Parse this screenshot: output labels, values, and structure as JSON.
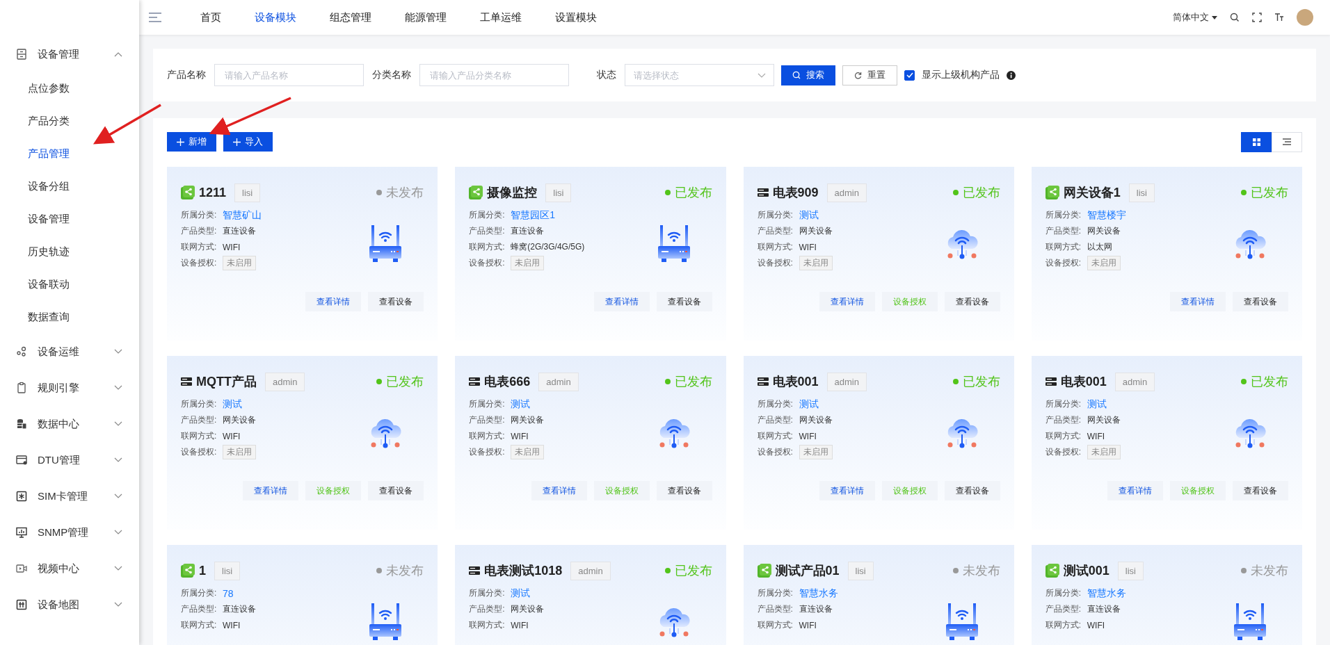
{
  "top_nav": {
    "tabs": [
      {
        "label": "首页",
        "selected": false
      },
      {
        "label": "设备模块",
        "selected": true
      },
      {
        "label": "组态管理",
        "selected": false
      },
      {
        "label": "能源管理",
        "selected": false
      },
      {
        "label": "工单运维",
        "selected": false
      },
      {
        "label": "设置模块",
        "selected": false
      }
    ],
    "language": "简体中文"
  },
  "sidebar": {
    "items": [
      {
        "label": "设备管理",
        "kind": "cabinet",
        "expanded": true,
        "children": [
          {
            "label": "点位参数",
            "selected": false
          },
          {
            "label": "产品分类",
            "selected": false
          },
          {
            "label": "产品管理",
            "selected": true
          },
          {
            "label": "设备分组",
            "selected": false
          },
          {
            "label": "设备管理",
            "selected": false
          },
          {
            "label": "历史轨迹",
            "selected": false
          },
          {
            "label": "设备联动",
            "selected": false
          },
          {
            "label": "数据查询",
            "selected": false
          }
        ]
      },
      {
        "label": "设备运维",
        "kind": "nodes",
        "expanded": false
      },
      {
        "label": "规则引擎",
        "kind": "clipboard",
        "expanded": false
      },
      {
        "label": "数据中心",
        "kind": "database",
        "expanded": false
      },
      {
        "label": "DTU管理",
        "kind": "dtu",
        "expanded": false
      },
      {
        "label": "SIM卡管理",
        "kind": "sim",
        "expanded": false
      },
      {
        "label": "SNMP管理",
        "kind": "monitor",
        "expanded": false
      },
      {
        "label": "视频中心",
        "kind": "video",
        "expanded": false
      },
      {
        "label": "设备地图",
        "kind": "map",
        "expanded": false
      }
    ]
  },
  "filter": {
    "fields": [
      {
        "label": "产品名称",
        "placeholder": "请输入产品名称",
        "kind": "input"
      },
      {
        "label": "分类名称",
        "placeholder": "请输入产品分类名称",
        "kind": "input"
      },
      {
        "label": "状态",
        "placeholder": "请选择状态",
        "kind": "select"
      }
    ],
    "search_button": "搜索",
    "reset_button": "重置",
    "show_parent": {
      "label": "显示上级机构产品",
      "checked": true
    }
  },
  "toolbar": {
    "add_button": "新增",
    "import_button": "导入",
    "view_modes": [
      {
        "kind": "grid",
        "selected": true
      },
      {
        "kind": "list",
        "selected": false
      }
    ]
  },
  "cards": [
    {
      "title": "1211",
      "owner": "lisi",
      "kind": "share-router",
      "status": "未发布",
      "published": false,
      "fields": [
        {
          "label": "所属分类:",
          "value": "智慧矿山",
          "kind": "link"
        },
        {
          "label": "产品类型:",
          "value": "直连设备",
          "kind": "text"
        },
        {
          "label": "联网方式:",
          "value": "WIFI",
          "kind": "text"
        },
        {
          "label": "设备授权:",
          "value": "未启用",
          "kind": "tag"
        }
      ],
      "actions": [
        {
          "label": "查看详情",
          "kind": "detail"
        },
        {
          "label": "查看设备",
          "kind": "device"
        }
      ]
    },
    {
      "title": "摄像监控",
      "owner": "lisi",
      "kind": "share-router",
      "status": "已发布",
      "published": true,
      "fields": [
        {
          "label": "所属分类:",
          "value": "智慧园区1",
          "kind": "link"
        },
        {
          "label": "产品类型:",
          "value": "直连设备",
          "kind": "text"
        },
        {
          "label": "联网方式:",
          "value": "蜂窝(2G/3G/4G/5G)",
          "kind": "text"
        },
        {
          "label": "设备授权:",
          "value": "未启用",
          "kind": "tag"
        }
      ],
      "actions": [
        {
          "label": "查看详情",
          "kind": "detail"
        },
        {
          "label": "查看设备",
          "kind": "device"
        }
      ]
    },
    {
      "title": "电表909",
      "owner": "admin",
      "kind": "meter-cloud",
      "status": "已发布",
      "published": true,
      "fields": [
        {
          "label": "所属分类:",
          "value": "测试",
          "kind": "link"
        },
        {
          "label": "产品类型:",
          "value": "网关设备",
          "kind": "text"
        },
        {
          "label": "联网方式:",
          "value": "WIFI",
          "kind": "text"
        },
        {
          "label": "设备授权:",
          "value": "未启用",
          "kind": "tag"
        }
      ],
      "actions": [
        {
          "label": "查看详情",
          "kind": "detail"
        },
        {
          "label": "设备授权",
          "kind": "auth"
        },
        {
          "label": "查看设备",
          "kind": "device"
        }
      ]
    },
    {
      "title": "网关设备1",
      "owner": "lisi",
      "kind": "share-cloud",
      "status": "已发布",
      "published": true,
      "fields": [
        {
          "label": "所属分类:",
          "value": "智慧楼宇",
          "kind": "link"
        },
        {
          "label": "产品类型:",
          "value": "网关设备",
          "kind": "text"
        },
        {
          "label": "联网方式:",
          "value": "以太网",
          "kind": "text"
        },
        {
          "label": "设备授权:",
          "value": "未启用",
          "kind": "tag"
        }
      ],
      "actions": [
        {
          "label": "查看详情",
          "kind": "detail"
        },
        {
          "label": "查看设备",
          "kind": "device"
        }
      ]
    },
    {
      "title": "MQTT产品",
      "owner": "admin",
      "kind": "meter-cloud",
      "status": "已发布",
      "published": true,
      "fields": [
        {
          "label": "所属分类:",
          "value": "测试",
          "kind": "link"
        },
        {
          "label": "产品类型:",
          "value": "网关设备",
          "kind": "text"
        },
        {
          "label": "联网方式:",
          "value": "WIFI",
          "kind": "text"
        },
        {
          "label": "设备授权:",
          "value": "未启用",
          "kind": "tag"
        }
      ],
      "actions": [
        {
          "label": "查看详情",
          "kind": "detail"
        },
        {
          "label": "设备授权",
          "kind": "auth"
        },
        {
          "label": "查看设备",
          "kind": "device"
        }
      ]
    },
    {
      "title": "电表666",
      "owner": "admin",
      "kind": "meter-cloud",
      "status": "已发布",
      "published": true,
      "fields": [
        {
          "label": "所属分类:",
          "value": "测试",
          "kind": "link"
        },
        {
          "label": "产品类型:",
          "value": "网关设备",
          "kind": "text"
        },
        {
          "label": "联网方式:",
          "value": "WIFI",
          "kind": "text"
        },
        {
          "label": "设备授权:",
          "value": "未启用",
          "kind": "tag"
        }
      ],
      "actions": [
        {
          "label": "查看详情",
          "kind": "detail"
        },
        {
          "label": "设备授权",
          "kind": "auth"
        },
        {
          "label": "查看设备",
          "kind": "device"
        }
      ]
    },
    {
      "title": "电表001",
      "owner": "admin",
      "kind": "meter-cloud",
      "status": "已发布",
      "published": true,
      "fields": [
        {
          "label": "所属分类:",
          "value": "测试",
          "kind": "link"
        },
        {
          "label": "产品类型:",
          "value": "网关设备",
          "kind": "text"
        },
        {
          "label": "联网方式:",
          "value": "WIFI",
          "kind": "text"
        },
        {
          "label": "设备授权:",
          "value": "未启用",
          "kind": "tag"
        }
      ],
      "actions": [
        {
          "label": "查看详情",
          "kind": "detail"
        },
        {
          "label": "设备授权",
          "kind": "auth"
        },
        {
          "label": "查看设备",
          "kind": "device"
        }
      ]
    },
    {
      "title": "电表001",
      "owner": "admin",
      "kind": "meter-cloud",
      "status": "已发布",
      "published": true,
      "fields": [
        {
          "label": "所属分类:",
          "value": "测试",
          "kind": "link"
        },
        {
          "label": "产品类型:",
          "value": "网关设备",
          "kind": "text"
        },
        {
          "label": "联网方式:",
          "value": "WIFI",
          "kind": "text"
        },
        {
          "label": "设备授权:",
          "value": "未启用",
          "kind": "tag"
        }
      ],
      "actions": [
        {
          "label": "查看详情",
          "kind": "detail"
        },
        {
          "label": "设备授权",
          "kind": "auth"
        },
        {
          "label": "查看设备",
          "kind": "device"
        }
      ]
    },
    {
      "title": "1",
      "owner": "lisi",
      "kind": "share-router",
      "status": "未发布",
      "published": false,
      "fields": [
        {
          "label": "所属分类:",
          "value": "78",
          "kind": "link"
        },
        {
          "label": "产品类型:",
          "value": "直连设备",
          "kind": "text"
        },
        {
          "label": "联网方式:",
          "value": "WIFI",
          "kind": "text"
        }
      ]
    },
    {
      "title": "电表测试1018",
      "owner": "admin",
      "kind": "meter-cloud",
      "status": "已发布",
      "published": true,
      "fields": [
        {
          "label": "所属分类:",
          "value": "测试",
          "kind": "link"
        },
        {
          "label": "产品类型:",
          "value": "网关设备",
          "kind": "text"
        },
        {
          "label": "联网方式:",
          "value": "WIFI",
          "kind": "text"
        }
      ]
    },
    {
      "title": "测试产品01",
      "owner": "lisi",
      "kind": "share-router",
      "status": "未发布",
      "published": false,
      "fields": [
        {
          "label": "所属分类:",
          "value": "智慧水务",
          "kind": "link"
        },
        {
          "label": "产品类型:",
          "value": "直连设备",
          "kind": "text"
        },
        {
          "label": "联网方式:",
          "value": "WIFI",
          "kind": "text"
        }
      ]
    },
    {
      "title": "测试001",
      "owner": "lisi",
      "kind": "share-router",
      "status": "未发布",
      "published": false,
      "fields": [
        {
          "label": "所属分类:",
          "value": "智慧水务",
          "kind": "link"
        },
        {
          "label": "产品类型:",
          "value": "直连设备",
          "kind": "text"
        },
        {
          "label": "联网方式:",
          "value": "WIFI",
          "kind": "text"
        }
      ]
    }
  ]
}
